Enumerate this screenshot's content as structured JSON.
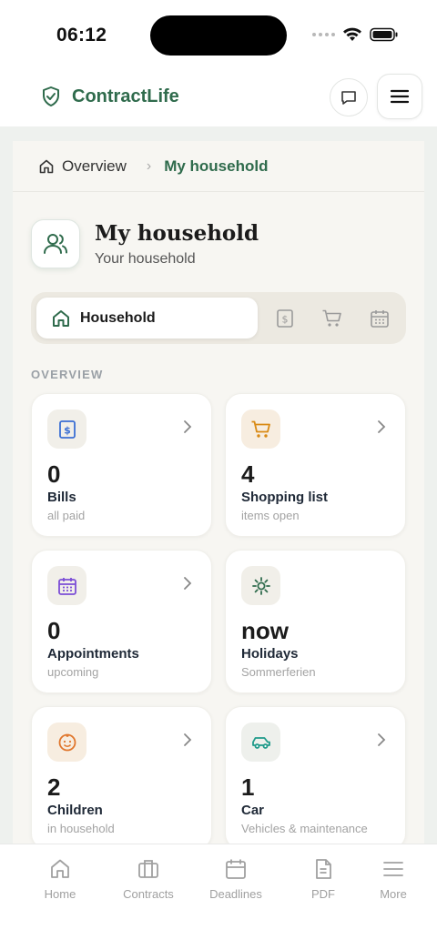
{
  "status_bar": {
    "time": "06:12"
  },
  "header": {
    "app_name": "ContractLife",
    "accent": "#2f6b4c"
  },
  "breadcrumb": {
    "home": "Overview",
    "current": "My household"
  },
  "page": {
    "title": "My household",
    "subtitle": "Your household"
  },
  "tabs": {
    "active_label": "Household",
    "others": [
      "bill-icon",
      "cart-icon",
      "calendar-icon"
    ]
  },
  "section": {
    "label": "OVERVIEW"
  },
  "cards": [
    {
      "value": "0",
      "title": "Bills",
      "subtitle": "all paid",
      "icon": "bill-icon",
      "color": "#3b6fd4",
      "bg": "#f1efe9"
    },
    {
      "value": "4",
      "title": "Shopping list",
      "subtitle": "items open",
      "icon": "cart-icon",
      "color": "#d98a14",
      "bg": "#f7ede0"
    },
    {
      "value": "0",
      "title": "Appointments",
      "subtitle": "upcoming",
      "icon": "calendar-icon",
      "color": "#7c4fd6",
      "bg": "#f1efe9"
    },
    {
      "value": "now",
      "title": "Holidays",
      "subtitle": "Sommerferien",
      "icon": "sun-icon",
      "color": "#2f6b4c",
      "bg": "#f1efe9"
    },
    {
      "value": "2",
      "title": "Children",
      "subtitle": "in household",
      "icon": "baby-icon",
      "color": "#e0762c",
      "bg": "#f7ede0"
    },
    {
      "value": "1",
      "title": "Car",
      "subtitle": "Vehicles & maintenance",
      "icon": "car-icon",
      "color": "#1f9a8a",
      "bg": "#eef0ec"
    }
  ],
  "nav": [
    {
      "label": "Home",
      "icon": "home-icon"
    },
    {
      "label": "Contracts",
      "icon": "briefcase-icon"
    },
    {
      "label": "Deadlines",
      "icon": "calendar-icon"
    },
    {
      "label": "PDF",
      "icon": "document-icon"
    },
    {
      "label": "More",
      "icon": "menu-icon"
    }
  ]
}
